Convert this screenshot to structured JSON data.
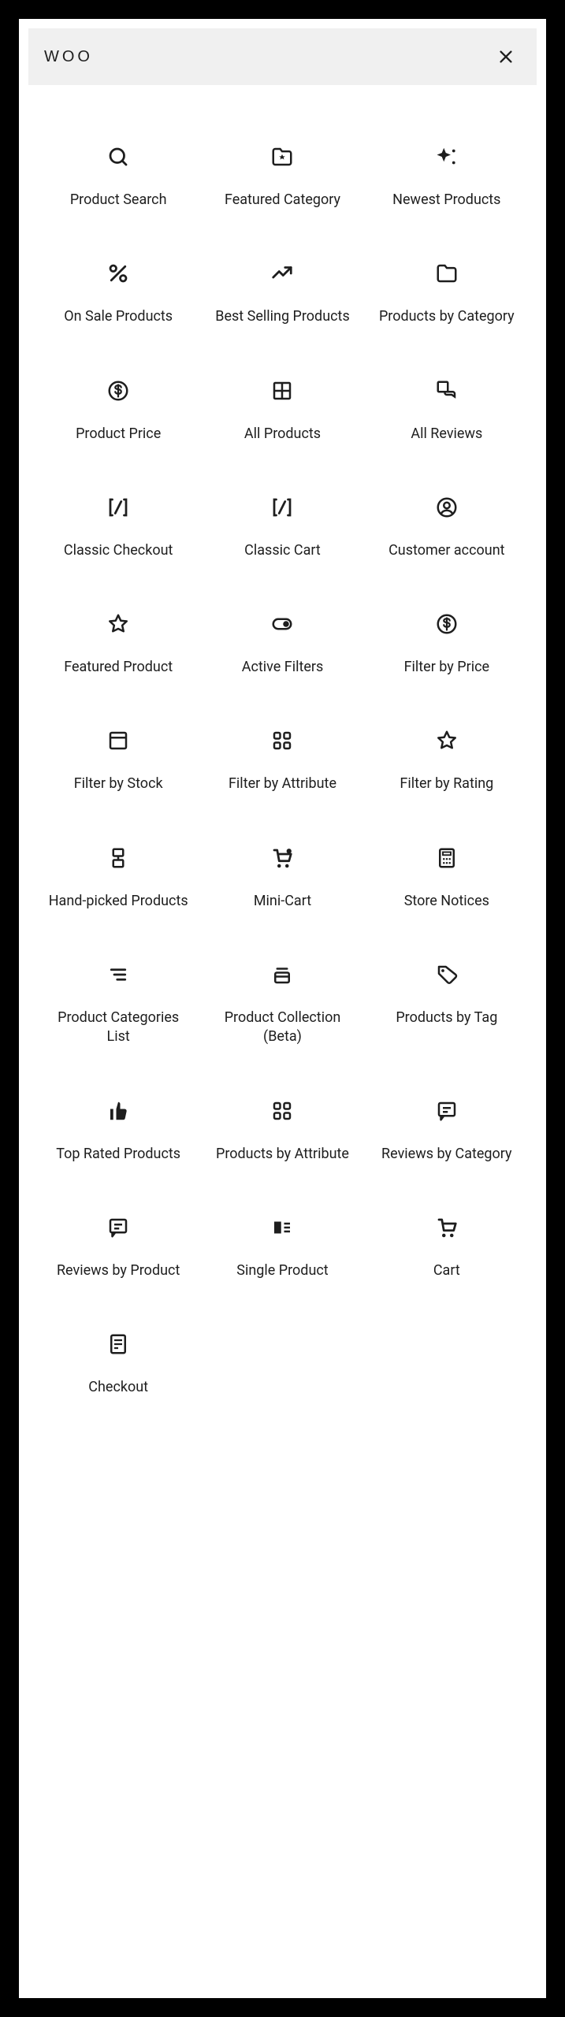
{
  "search": {
    "value": "WOO"
  },
  "blocks": [
    {
      "id": "product-search",
      "label": "Product Search",
      "icon": "search"
    },
    {
      "id": "featured-category",
      "label": "Featured Category",
      "icon": "folder-star"
    },
    {
      "id": "newest-products",
      "label": "Newest Products",
      "icon": "sparkles"
    },
    {
      "id": "on-sale-products",
      "label": "On Sale Products",
      "icon": "percent"
    },
    {
      "id": "best-selling-products",
      "label": "Best Selling Products",
      "icon": "trend-up"
    },
    {
      "id": "products-by-category",
      "label": "Products by Category",
      "icon": "folder"
    },
    {
      "id": "product-price",
      "label": "Product Price",
      "icon": "dollar-circle"
    },
    {
      "id": "all-products",
      "label": "All Products",
      "icon": "grid-4"
    },
    {
      "id": "all-reviews",
      "label": "All Reviews",
      "icon": "reviews"
    },
    {
      "id": "classic-checkout",
      "label": "Classic Checkout",
      "icon": "shortcode"
    },
    {
      "id": "classic-cart",
      "label": "Classic Cart",
      "icon": "shortcode"
    },
    {
      "id": "customer-account",
      "label": "Customer account",
      "icon": "user-circle"
    },
    {
      "id": "featured-product",
      "label": "Featured Product",
      "icon": "star-outline"
    },
    {
      "id": "active-filters",
      "label": "Active Filters",
      "icon": "toggle-on"
    },
    {
      "id": "filter-by-price",
      "label": "Filter by Price",
      "icon": "dollar-circle"
    },
    {
      "id": "filter-by-stock",
      "label": "Filter by Stock",
      "icon": "box"
    },
    {
      "id": "filter-by-attribute",
      "label": "Filter by Attribute",
      "icon": "grid-dots"
    },
    {
      "id": "filter-by-rating",
      "label": "Filter by Rating",
      "icon": "star-outline"
    },
    {
      "id": "hand-picked-products",
      "label": "Hand-picked Products",
      "icon": "handpick"
    },
    {
      "id": "mini-cart",
      "label": "Mini-Cart",
      "icon": "mini-cart"
    },
    {
      "id": "store-notices",
      "label": "Store Notices",
      "icon": "calc"
    },
    {
      "id": "product-categories-list",
      "label": "Product Categories List",
      "icon": "filter-lines"
    },
    {
      "id": "product-collection",
      "label": "Product Collection (Beta)",
      "icon": "stack"
    },
    {
      "id": "products-by-tag",
      "label": "Products by Tag",
      "icon": "tag"
    },
    {
      "id": "top-rated-products",
      "label": "Top Rated Products",
      "icon": "thumb-up"
    },
    {
      "id": "products-by-attribute",
      "label": "Products by Attribute",
      "icon": "grid-dots"
    },
    {
      "id": "reviews-by-category",
      "label": "Reviews by Category",
      "icon": "chat-square"
    },
    {
      "id": "reviews-by-product",
      "label": "Reviews by Product",
      "icon": "chat-square"
    },
    {
      "id": "single-product",
      "label": "Single Product",
      "icon": "single-list"
    },
    {
      "id": "cart",
      "label": "Cart",
      "icon": "cart"
    },
    {
      "id": "checkout",
      "label": "Checkout",
      "icon": "receipt"
    }
  ]
}
